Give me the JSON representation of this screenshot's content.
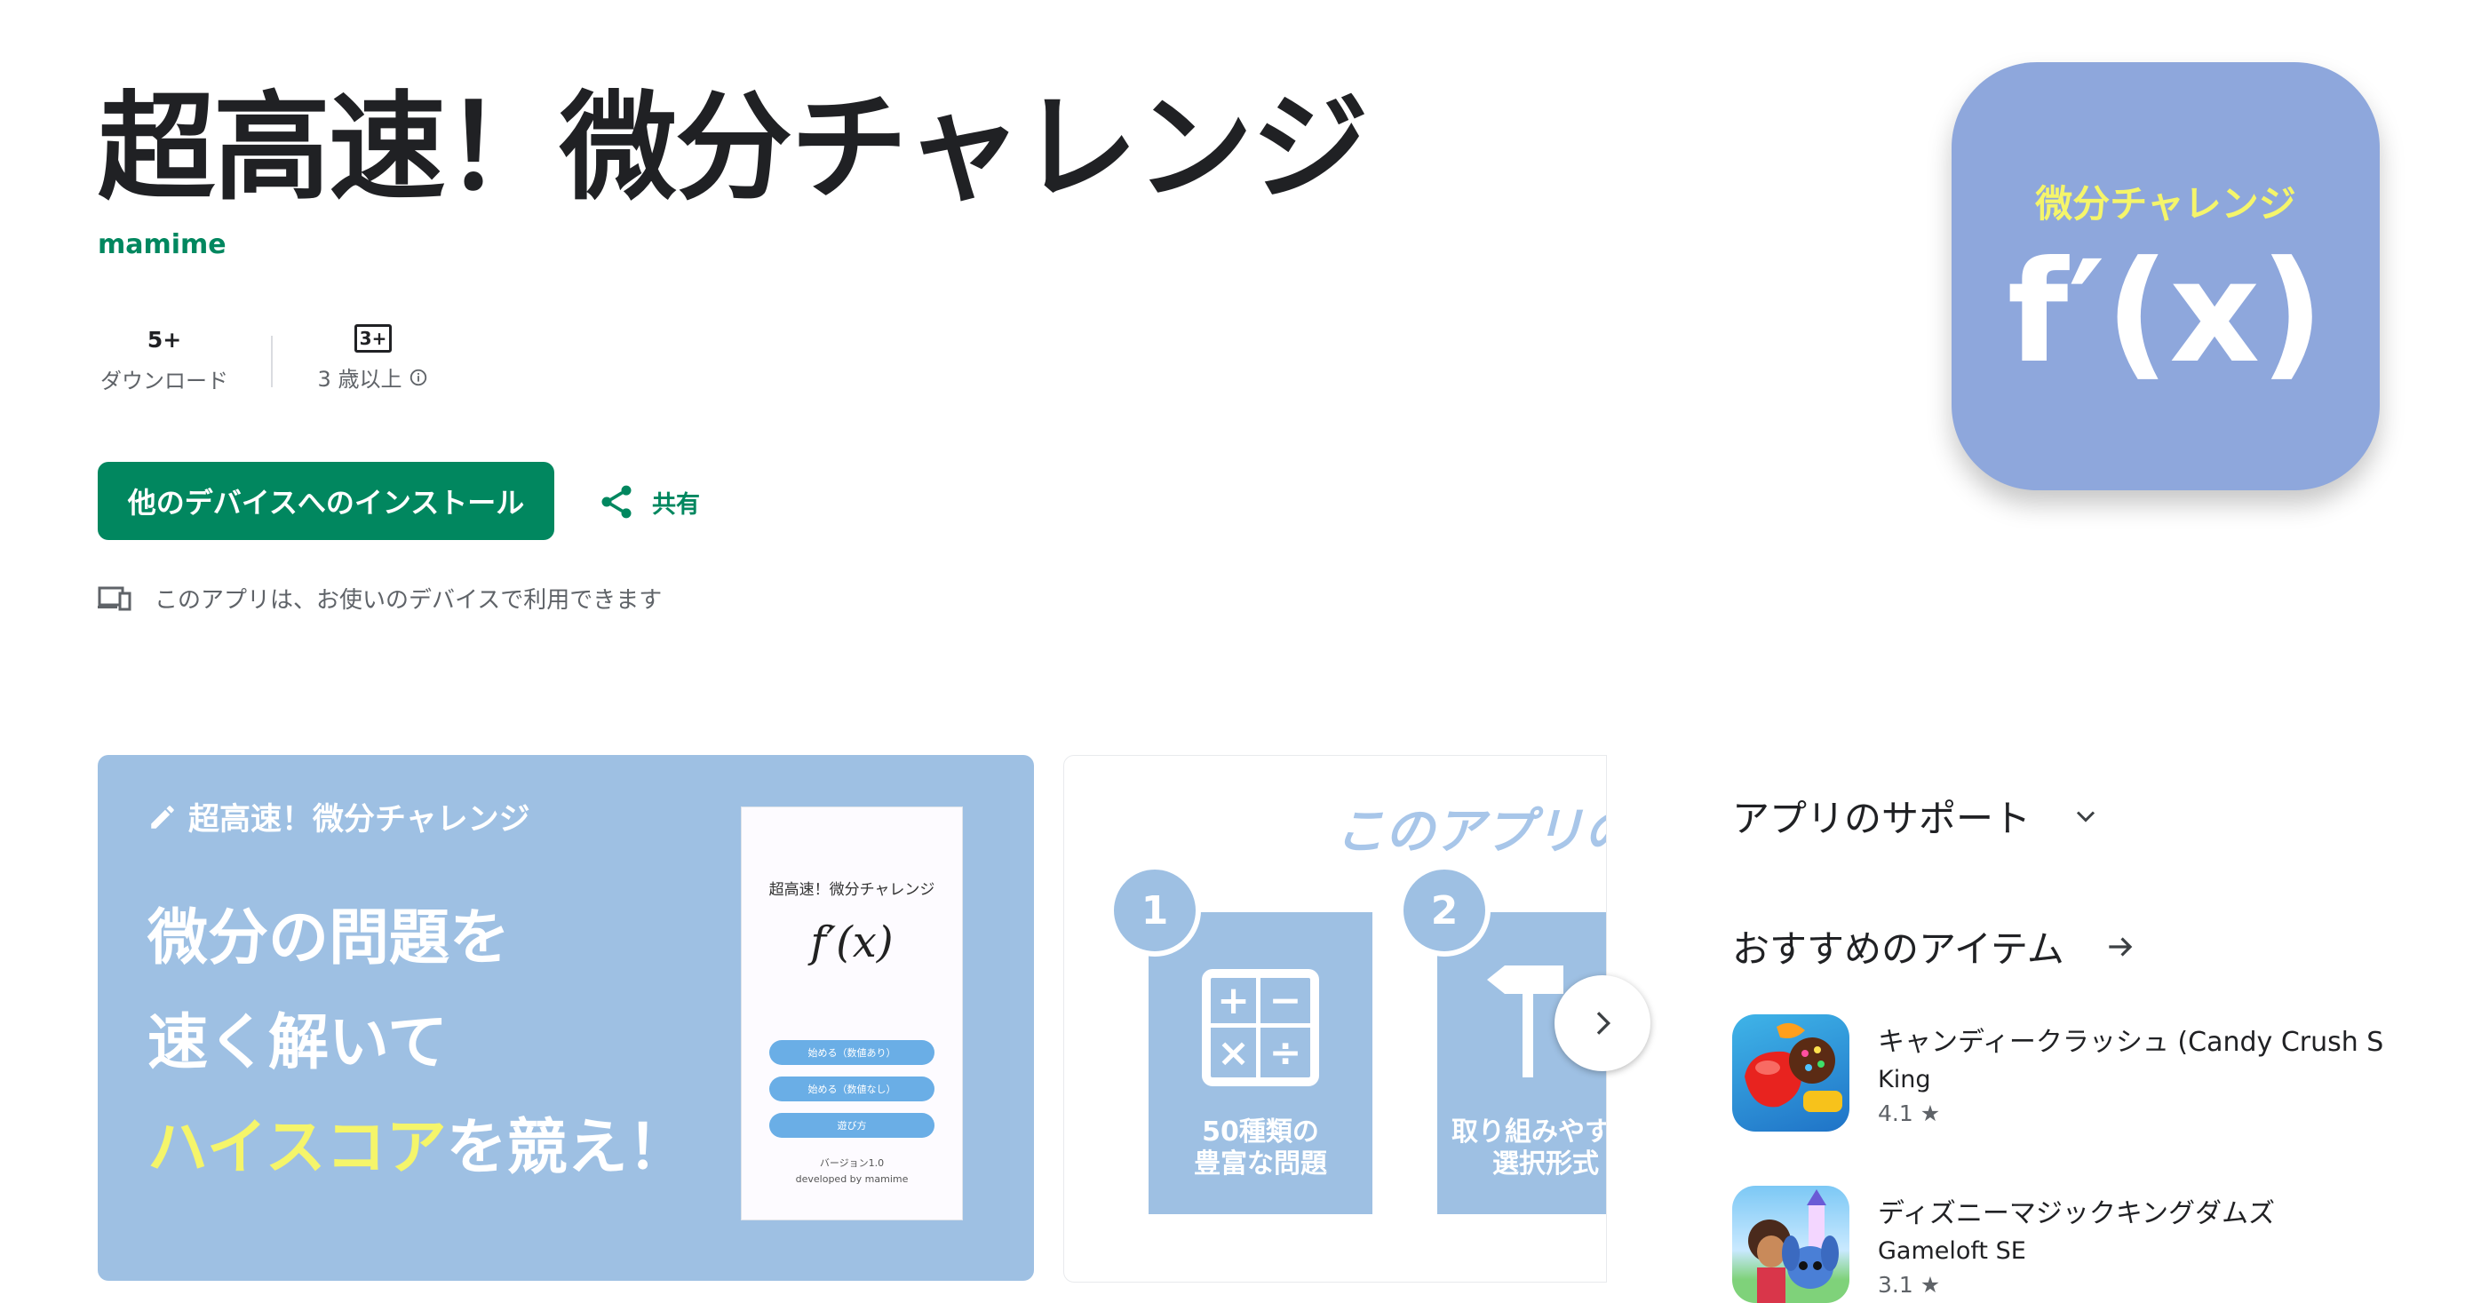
{
  "app": {
    "title": "超高速！微分チャレンジ",
    "developer": "mamime"
  },
  "stats": {
    "downloads_value": "5+",
    "downloads_label": "ダウンロード",
    "rating_badge": "3+",
    "rating_label": "3 歳以上"
  },
  "actions": {
    "install_label": "他のデバイスへのインストール",
    "share_label": "共有",
    "availability": "このアプリは、お使いのデバイスで利用できます"
  },
  "icon": {
    "subtitle": "微分チャレンジ",
    "main": "f′(x)",
    "bg_color": "#8ea7dc",
    "subtitle_color": "#f5f56a"
  },
  "screenshot1": {
    "header": "超高速！微分チャレンジ",
    "line1": "微分の問題を",
    "line2": "速く解いて",
    "line3_highlight": "ハイスコア",
    "line3_rest": "を競え！",
    "phone": {
      "title": "超高速！微分チャレンジ",
      "formula": "f′(x)",
      "button1": "始める（数値あり）",
      "button2": "始める（数値なし）",
      "button3": "遊び方",
      "version": "バージョン1.0",
      "developed_by": "developed by mamime"
    }
  },
  "screenshot2": {
    "title": "このアプリの",
    "card1_number": "1",
    "card1_text_line1": "50種類の",
    "card1_text_line2": "豊富な問題",
    "card2_number": "2",
    "card2_text_line1": "取り組みやす",
    "card2_text_line2": "選択形式"
  },
  "sidebar": {
    "support_label": "アプリのサポート",
    "recommended_label": "おすすめのアイテム",
    "apps": [
      {
        "name": "キャンディークラッシュ (Candy Crush S",
        "developer": "King",
        "rating": "4.1"
      },
      {
        "name": "ディズニーマジックキングダムズ",
        "developer": "Gameloft SE",
        "rating": "3.1"
      }
    ]
  },
  "colors": {
    "accent": "#01875f",
    "screenshot_bg": "#9ec0e3"
  }
}
